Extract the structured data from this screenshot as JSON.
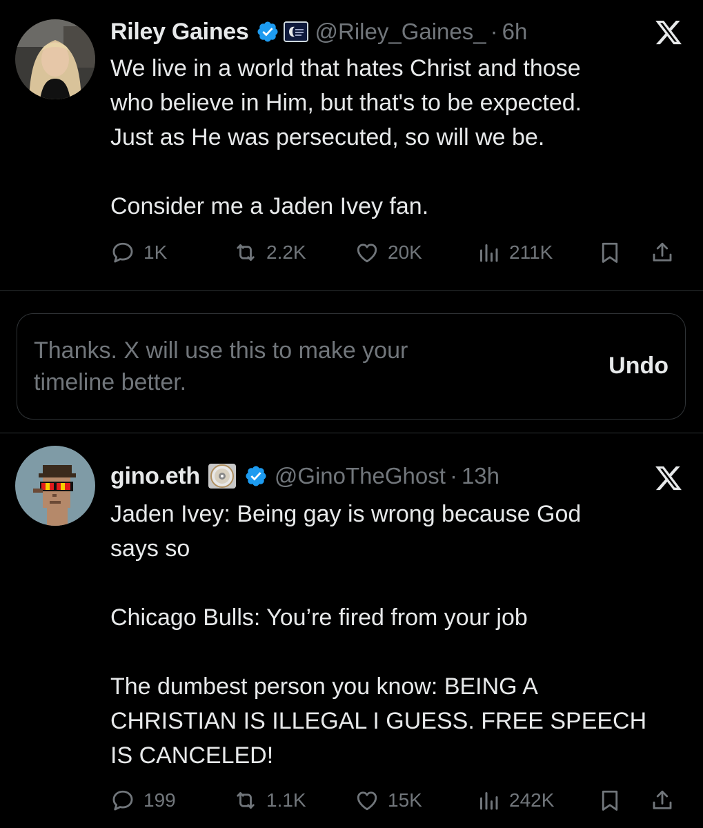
{
  "tweet1": {
    "name": "Riley Gaines",
    "handle": "@Riley_Gaines_",
    "separator": "·",
    "time": "6h",
    "lines": [
      "We live in a world that hates Christ and those",
      "who believe in Him, but that's to be expected.",
      "Just as He was persecuted, so will we be.",
      "",
      "Consider me a Jaden Ivey fan."
    ],
    "stats": {
      "replies": "1K",
      "reposts": "2.2K",
      "likes": "20K",
      "views": "211K"
    },
    "icons": {
      "verified": "verified-badge-icon",
      "affiliate": "affiliate-badge-icon",
      "platform": "x-logo-icon"
    }
  },
  "notice": {
    "text_line1": "Thanks. X will use this to make your",
    "text_line2": "timeline better.",
    "undo_label": "Undo"
  },
  "tweet2": {
    "name": "gino.eth",
    "handle": "@GinoTheGhost",
    "separator": "·",
    "time": "13h",
    "lines": [
      "Jaden Ivey: Being gay is wrong because God",
      "says so",
      "",
      "Chicago Bulls: You’re fired from your job",
      "",
      "The dumbest person you know: BEING A",
      "CHRISTIAN IS ILLEGAL I GUESS. FREE SPEECH",
      "IS CANCELED!"
    ],
    "stats": {
      "replies": "199",
      "reposts": "1.1K",
      "likes": "15K",
      "views": "242K"
    },
    "icons": {
      "disc": "compact-disc-icon",
      "verified": "verified-badge-icon",
      "platform": "x-logo-icon"
    }
  },
  "colors": {
    "background": "#000000",
    "text_primary": "#e7e9ea",
    "text_secondary": "#71767b",
    "verified_blue": "#1d9bf0",
    "divider": "#2f3336"
  }
}
